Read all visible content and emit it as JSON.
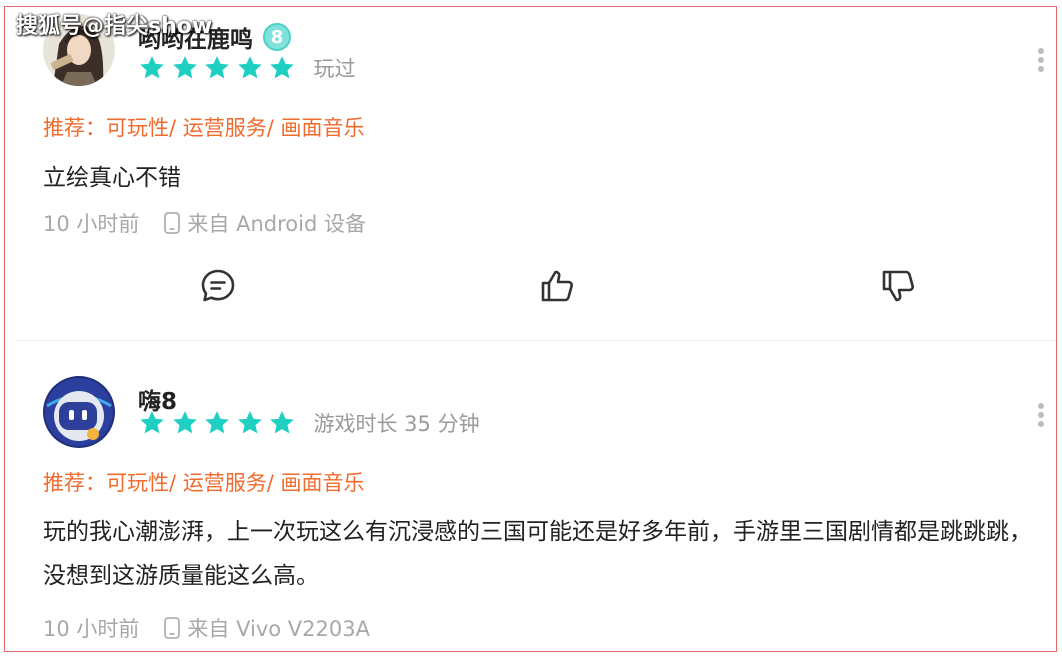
{
  "watermark": "搜狐号@指尖show",
  "reviews": [
    {
      "username": "哟哟在鹿鸣",
      "level": "8",
      "rating": 5,
      "play_status": "玩过",
      "tags": "推荐：可玩性/ 运营服务/ 画面音乐",
      "content": "立绘真心不错",
      "time": "10 小时前",
      "device": "来自 Android 设备"
    },
    {
      "username": "嗨8",
      "rating": 5,
      "play_status": "游戏时长 35 分钟",
      "tags": "推荐：可玩性/ 运营服务/ 画面音乐",
      "content": "玩的我心潮澎湃，上一次玩这么有沉浸感的三国可能还是好多年前，手游里三国剧情都是跳跳跳，没想到这游质量能这么高。",
      "time": "10 小时前",
      "device": "来自 Vivo V2203A"
    }
  ],
  "colors": {
    "star": "#1ecfc2",
    "tag": "#f26b2e",
    "meta": "#a8a8a8",
    "border": "#e06a6a"
  },
  "icons": {
    "reply": "comment-icon",
    "like": "thumbs-up-icon",
    "dislike": "thumbs-down-icon",
    "more": "more-vertical-icon",
    "device": "phone-icon"
  }
}
